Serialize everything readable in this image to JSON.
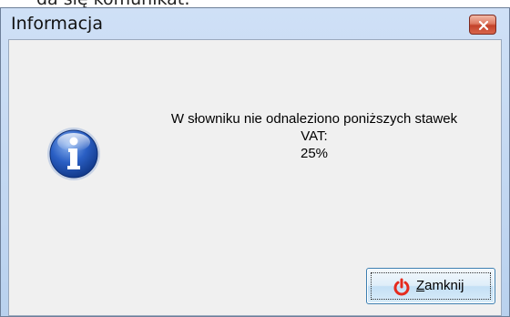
{
  "background_text": "da się komunikat:",
  "dialog": {
    "title": "Informacja",
    "icon": "info-icon",
    "message_lines": [
      "W słowniku nie odnaleziono poniższych stawek",
      "VAT:",
      "25%"
    ],
    "button": {
      "label_underlined": "Z",
      "label_rest": "amknij",
      "icon": "power-icon"
    }
  },
  "colors": {
    "close_button": "#c3422a",
    "power_icon": "#e52b1e",
    "info_blue": "#1f4fa8"
  }
}
